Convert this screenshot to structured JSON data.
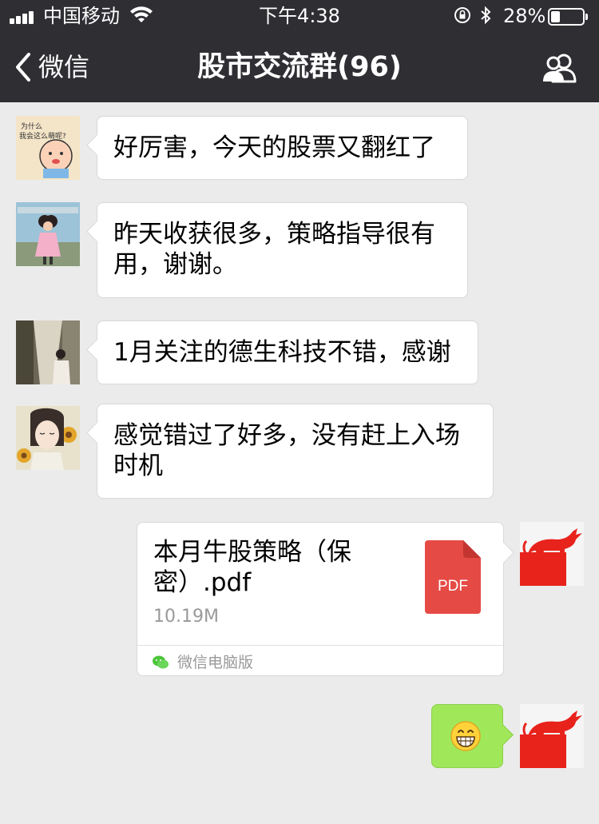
{
  "status_bar": {
    "carrier": "中国移动",
    "time": "下午4:38",
    "battery_percent": "28%",
    "battery_level": 0.28,
    "icons": [
      "signal-icon",
      "wifi-icon",
      "rotation-lock-icon",
      "bluetooth-icon",
      "battery-icon"
    ]
  },
  "nav": {
    "back_label": "微信",
    "title": "股市交流群(96)",
    "members_icon": "group-members-icon"
  },
  "messages": [
    {
      "side": "left",
      "type": "text",
      "text": "好厉害，今天的股票又翻红了"
    },
    {
      "side": "left",
      "type": "text",
      "text": "昨天收获很多，策略指导很有用，谢谢。"
    },
    {
      "side": "left",
      "type": "text",
      "text": "1月关注的德生科技不错，感谢"
    },
    {
      "side": "left",
      "type": "text",
      "text": "感觉错过了好多，没有赶上入场时机"
    },
    {
      "side": "right",
      "type": "file",
      "file_name": "本月牛股策略（保密）.pdf",
      "file_size": "10.19M",
      "file_icon_label": "PDF",
      "source": "微信电脑版"
    },
    {
      "side": "right",
      "type": "emoji",
      "emoji": "grinning-face-icon"
    }
  ],
  "colors": {
    "nav_bg": "#2e2e33",
    "chat_bg": "#ebebeb",
    "bubble_self": "#a0e75a",
    "pdf_red": "#e54a45",
    "bull_red": "#e8231c"
  }
}
